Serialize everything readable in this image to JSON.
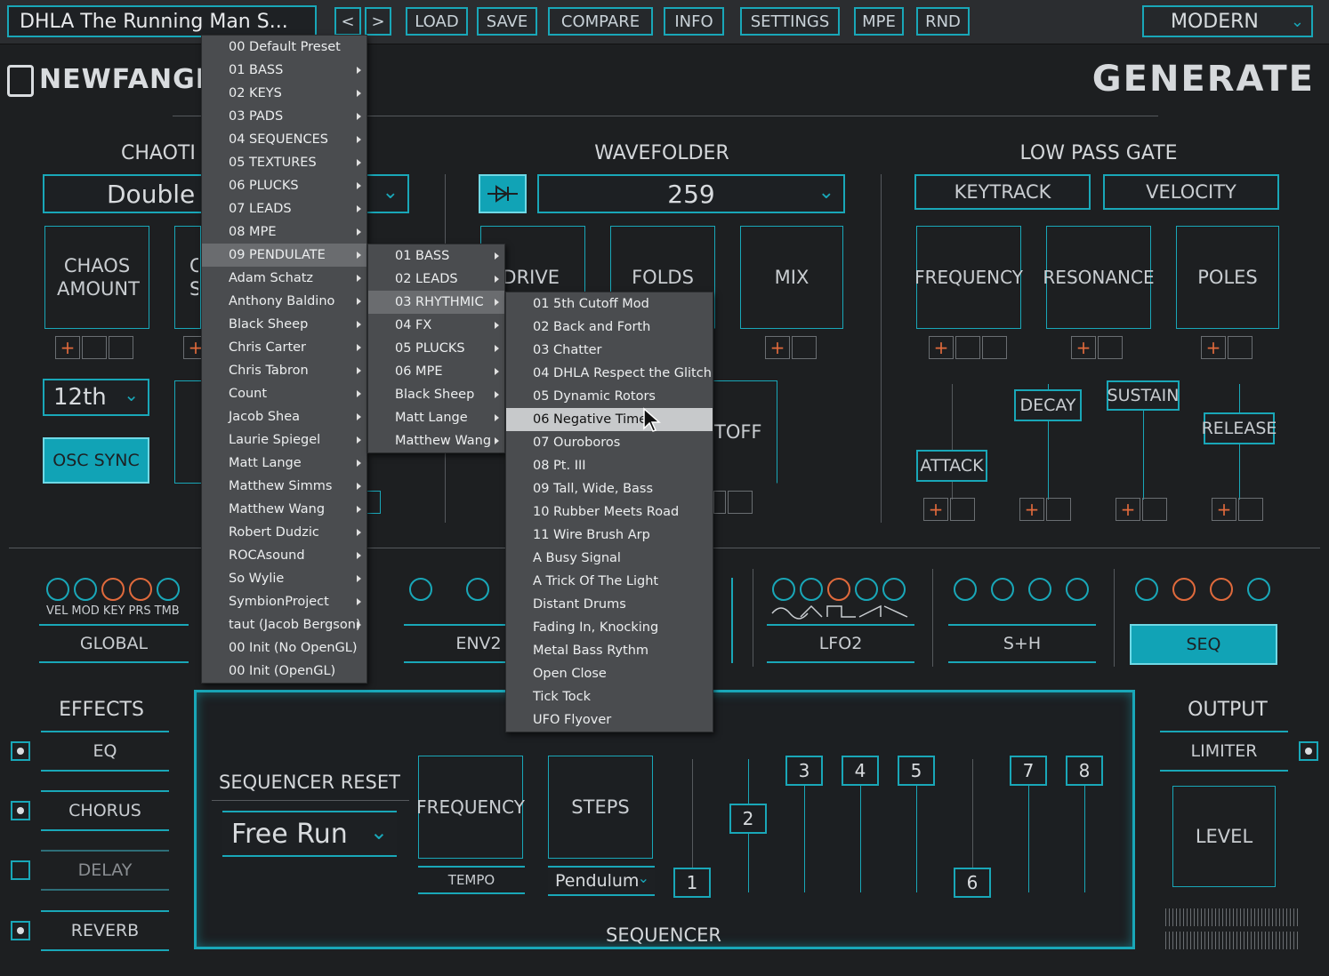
{
  "header": {
    "preset_name": "DHLA The Running Man S...",
    "nav_prev": "<",
    "nav_next": ">",
    "buttons": [
      "LOAD",
      "SAVE",
      "COMPARE",
      "INFO",
      "SETTINGS",
      "MPE",
      "RND"
    ],
    "mode": "MODERN",
    "brand": "NEWFANGL",
    "page_title": "GENERATE"
  },
  "chaotic": {
    "title": "CHAOTI",
    "type_value": "Double",
    "chaos_amount": "CHAOS AMOUNT",
    "knob2": "C S",
    "octave": "12th",
    "osc_sync": "OSC SYNC"
  },
  "wavefolder": {
    "title": "WAVEFOLDER",
    "value": "259",
    "drive": "DRIVE",
    "folds": "FOLDS",
    "mix": "MIX",
    "cutoff": "TOFF"
  },
  "lpg": {
    "title": "LOW PASS GATE",
    "keytrack": "KEYTRACK",
    "velocity": "VELOCITY",
    "frequency": "FREQUENCY",
    "resonance": "RESONANCE",
    "poles": "POLES",
    "attack": "ATTACK",
    "decay": "DECAY",
    "sustain": "SUSTAIN",
    "release": "RELEASE"
  },
  "modulators": {
    "global_labels": [
      "VEL",
      "MOD",
      "KEY",
      "PRS",
      "TMB"
    ],
    "global": "GLOBAL",
    "env2": "ENV2",
    "lfo2": "LFO2",
    "sh": "S+H",
    "seq": "SEQ"
  },
  "effects": {
    "title": "EFFECTS",
    "items": [
      "EQ",
      "CHORUS",
      "DELAY",
      "REVERB"
    ]
  },
  "sequencer": {
    "title": "SEQUENCER",
    "reset_title": "SEQUENCER RESET",
    "reset_value": "Free Run",
    "frequency": "FREQUENCY",
    "tempo": "TEMPO",
    "steps": "STEPS",
    "mode_value": "Pendulum",
    "step_labels": [
      "1",
      "2",
      "3",
      "4",
      "5",
      "6",
      "7",
      "8"
    ]
  },
  "output": {
    "title": "OUTPUT",
    "limiter": "LIMITER",
    "level": "LEVEL"
  },
  "menu1": [
    "00 Default Preset",
    "01 BASS",
    "02 KEYS",
    "03 PADS",
    "04 SEQUENCES",
    "05 TEXTURES",
    "06 PLUCKS",
    "07 LEADS",
    "08 MPE",
    "09 PENDULATE",
    "Adam Schatz",
    "Anthony Baldino",
    "Black Sheep",
    "Chris Carter",
    "Chris Tabron",
    "Count",
    "Jacob Shea",
    "Laurie Spiegel",
    "Matt Lange",
    "Matthew Simms",
    "Matthew Wang",
    "Robert Dudzic",
    "ROCAsound",
    "So Wylie",
    "SymbionProject",
    "taut (Jacob Bergson)",
    "00 Init (No OpenGL)",
    "00 Init (OpenGL)"
  ],
  "menu2": [
    "01 BASS",
    "02 LEADS",
    "03 RHYTHMIC",
    "04 FX",
    "05 PLUCKS",
    "06 MPE",
    "Black Sheep",
    "Matt Lange",
    "Matthew Wang"
  ],
  "menu3": [
    "01 5th Cutoff Mod",
    "02 Back and Forth",
    "03 Chatter",
    "04 DHLA Respect the Glitch",
    "05 Dynamic Rotors",
    "06 Negative Time",
    "07 Ouroboros",
    "08 Pt. III",
    "09 Tall, Wide, Bass",
    "10 Rubber Meets Road",
    "11 Wire Brush Arp",
    "A Busy Signal",
    "A Trick Of The Light",
    "Distant Drums",
    "Fading In, Knocking",
    "Metal Bass Rythm",
    "Open Close",
    "Tick Tock",
    "UFO Flyover"
  ],
  "colors": {
    "accent": "#19a7b8",
    "mod": "#e06a3c",
    "bg": "#1d1f21"
  }
}
